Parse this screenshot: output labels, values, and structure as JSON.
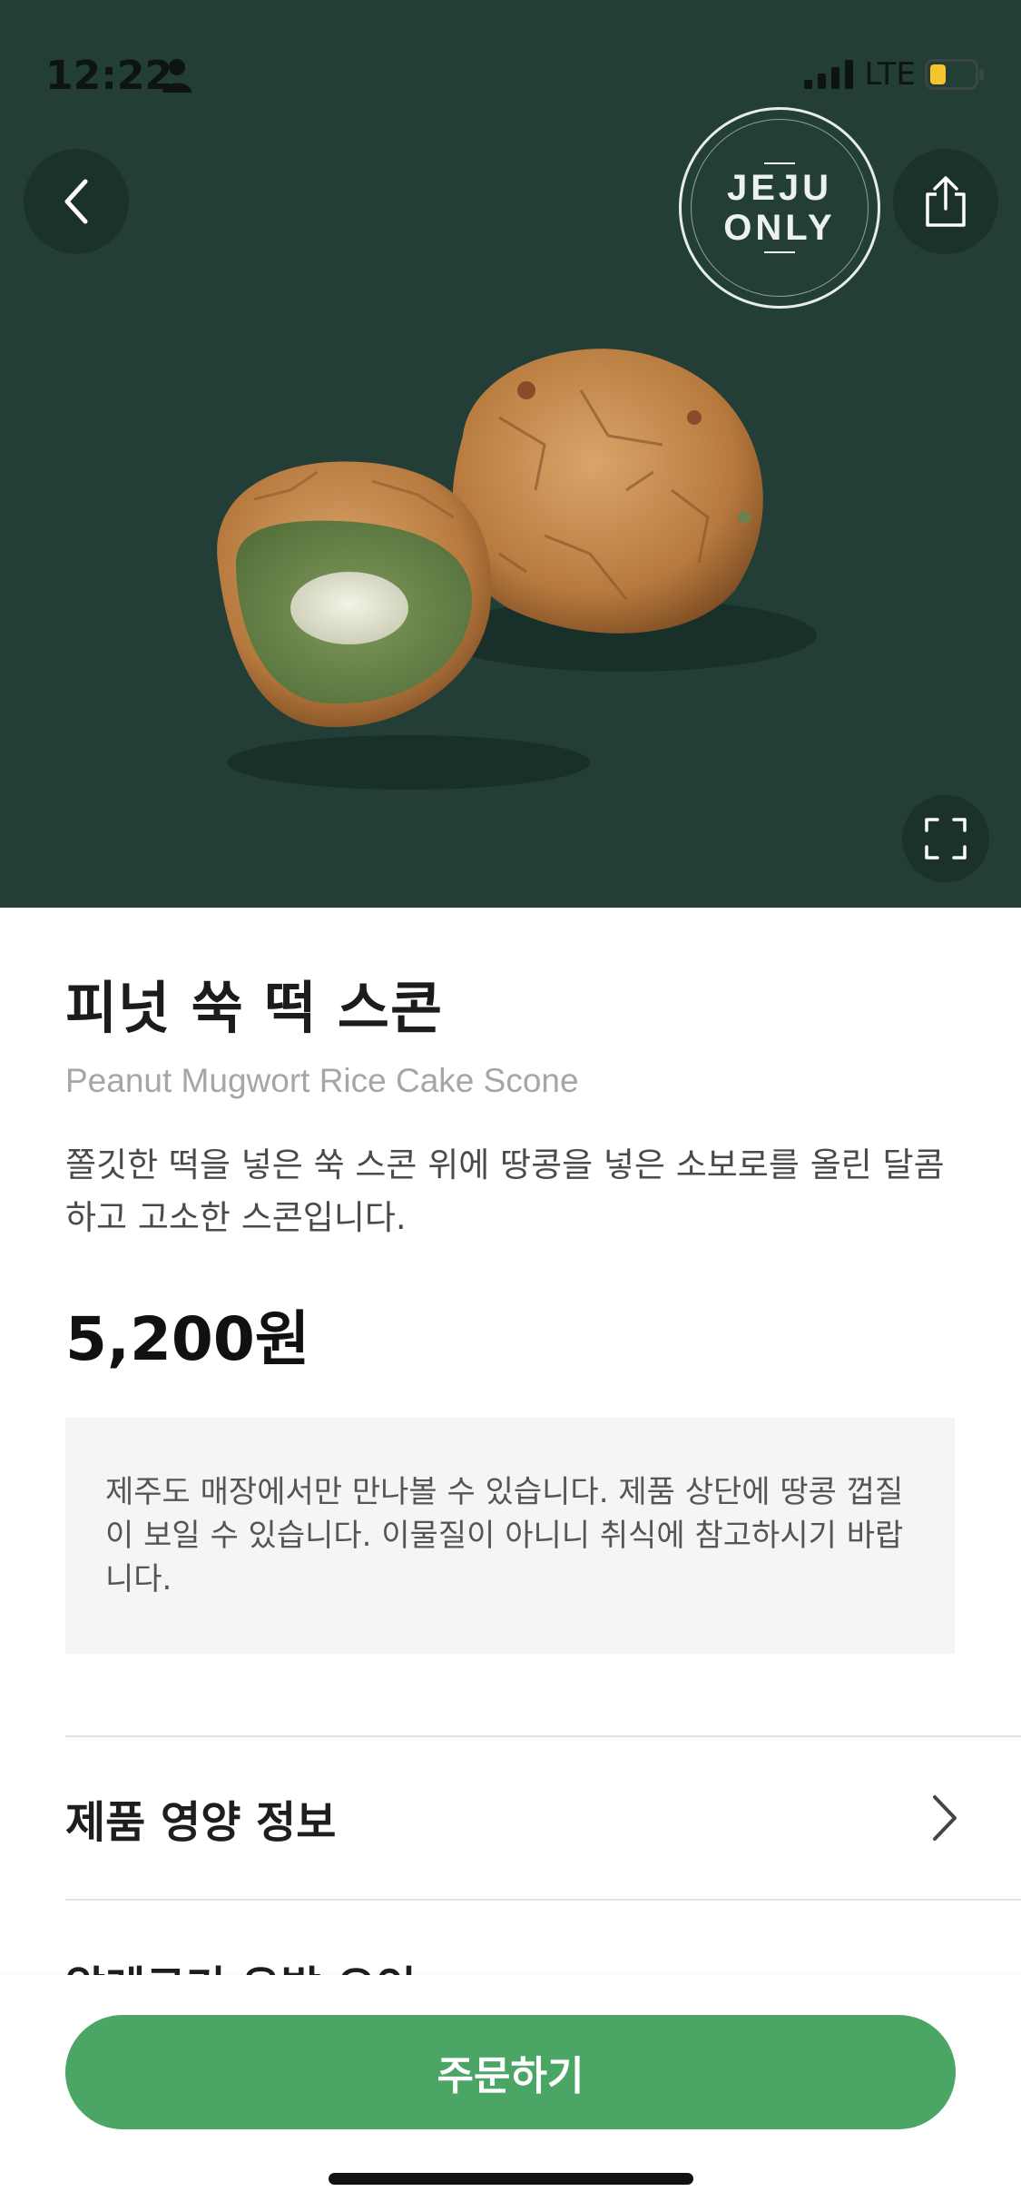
{
  "status_bar": {
    "time": "12:22",
    "network": "LTE",
    "signal_bars": 4,
    "battery_level": 0.35,
    "battery_color": "#f5c52c"
  },
  "hero": {
    "background_color": "#223e37",
    "badge_line1": "JEJU",
    "badge_line2": "ONLY",
    "back_icon": "chevron-left-icon",
    "share_icon": "share-icon",
    "expand_icon": "expand-icon"
  },
  "product": {
    "name_ko": "피넛 쑥 떡 스콘",
    "name_en": "Peanut Mugwort Rice Cake Scone",
    "description": "쫄깃한 떡을 넣은 쑥 스콘 위에 땅콩을 넣은 소보로를 올린 달콤하고 고소한 스콘입니다.",
    "price": "5,200원",
    "notice": "제주도 매장에서만 만나볼 수 있습니다. 제품 상단에 땅콩 껍질이 보일 수 있습니다. 이물질이 아니니 취식에 참고하시기 바랍니다."
  },
  "sections": {
    "nutrition_label": "제품 영양 정보",
    "allergy_label": "알레르기 유발 요인"
  },
  "footer": {
    "order_label": "주문하기",
    "accent_color": "#4ba565"
  }
}
